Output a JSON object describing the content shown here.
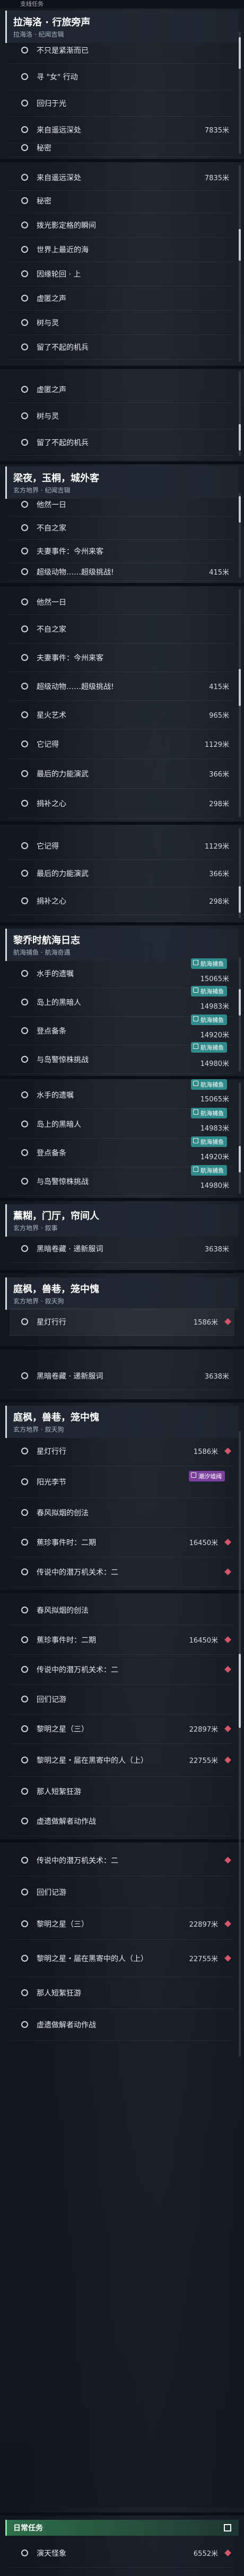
{
  "topbar": {
    "label": "支线任务"
  },
  "block1": {
    "header": {
      "title": "拉海洛 · 行旅旁声",
      "sub": "拉海洛 · 纪闻吉辑"
    },
    "rows": [
      {
        "label": "不只是紧渐而已"
      },
      {
        "label": "寻 \"女\" 行动"
      },
      {
        "label": "回归于光"
      },
      {
        "label": "来自遥远深处",
        "dist": "7835米"
      },
      {
        "label": "秘密"
      },
      {
        "label": "拨光影定格的瞬间"
      }
    ]
  },
  "block2": {
    "rows": [
      {
        "label": "来自遥远深处",
        "dist": "7835米"
      },
      {
        "label": "秘密"
      },
      {
        "label": "拨光影定格的瞬间"
      },
      {
        "label": "世界上最近的海"
      },
      {
        "label": "因缘轮回 · 上"
      },
      {
        "label": "虚匿之声"
      },
      {
        "label": "树与灵"
      },
      {
        "label": "留了不起的机兵"
      }
    ]
  },
  "block3": {
    "rows": [
      {
        "label": "虚匿之声"
      },
      {
        "label": "树与灵"
      },
      {
        "label": "留了不起的机兵"
      }
    ]
  },
  "block4": {
    "header": {
      "title": "梁夜，玉桐，城外客",
      "sub": "玄方地界 · 纪闻吉辑"
    },
    "rows": [
      {
        "label": "他然一日"
      },
      {
        "label": "不自之家"
      },
      {
        "label": "夫妻事件：今州来客"
      },
      {
        "label": "超级动物……超级挑战!",
        "dist": "415米"
      }
    ]
  },
  "block5": {
    "rows": [
      {
        "label": "他然一日"
      },
      {
        "label": "不自之家"
      },
      {
        "label": "夫妻事件：今州来客"
      },
      {
        "label": "超级动物……超级挑战!",
        "dist": "415米"
      },
      {
        "label": "星火艺术",
        "dist": "965米"
      },
      {
        "label": "它记得",
        "dist": "1129米"
      },
      {
        "label": "最后的力能演武",
        "dist": "366米"
      },
      {
        "label": "捐补之心",
        "dist": "298米"
      }
    ]
  },
  "block6": {
    "rows": [
      {
        "label": "它记得",
        "dist": "1129米"
      },
      {
        "label": "最后的力能演武",
        "dist": "366米"
      },
      {
        "label": "捐补之心",
        "dist": "298米"
      }
    ]
  },
  "block7": {
    "header": {
      "title": "黎乔时航海日志",
      "sub": "航海捕鱼 · 航海奇遇"
    },
    "badge": "航海捕鱼",
    "rows": [
      {
        "label": "水手的遗嘱",
        "dist": "15065米"
      },
      {
        "label": "岛上的黑暗人",
        "dist": "14983米"
      },
      {
        "label": "登点备条",
        "dist": "14920米"
      },
      {
        "label": "与岛警惊株挑战",
        "dist": "14980米"
      }
    ]
  },
  "block8": {
    "rows": [
      {
        "label": "水手的遗嘱",
        "dist": "15065米"
      },
      {
        "label": "岛上的黑暗人",
        "dist": "14983米"
      },
      {
        "label": "登点备条",
        "dist": "14920米"
      },
      {
        "label": "与岛警惊株挑战",
        "dist": "14980米"
      }
    ]
  },
  "block9": {
    "header": {
      "title": "薰糊，门厅，帘间人",
      "sub": "玄方地界 · 叙事"
    },
    "rows": [
      {
        "label": "黑暗卷藏 · 递新服词",
        "dist": "3638米"
      }
    ]
  },
  "block10": {
    "header": {
      "title": "庭枫，兽巷，笼中愧",
      "sub": "玄方地界 · 叙天狗"
    },
    "rows": [
      {
        "label": "星灯行行",
        "dist": "1586米"
      }
    ]
  },
  "block11": {
    "rows": [
      {
        "label": "黑暗卷藏 · 递新服词",
        "dist": "3638米"
      }
    ]
  },
  "block12": {
    "header": {
      "title": "庭枫，兽巷，笼中愧",
      "sub": "玄方地界 · 叙天狗"
    },
    "badge": "潮汐墟阈",
    "rows": [
      {
        "label": "星灯行行",
        "dist": "1586米"
      },
      {
        "label": "阳光李节"
      },
      {
        "label": "春风拟烟的创法"
      },
      {
        "label": "蕉珍事件时：二期",
        "dist": "16450米"
      },
      {
        "label": "传说中的潜万机关术：二"
      },
      {
        "label": "春风拟烟的创法"
      },
      {
        "label": "蕉珍事件时：二期",
        "dist": "16450米"
      },
      {
        "label": "传说中的潜万机关术：二"
      },
      {
        "label": "回们记游"
      },
      {
        "label": "黎明之星（三）",
        "dist": "22897米"
      },
      {
        "label": "黎明之星・届在黑寄中的人（上）",
        "dist": "22755米"
      },
      {
        "label": "那人短絮狂游"
      },
      {
        "label": "虚遗做解者动作战"
      },
      {
        "label": "传说中的潜万机关术：二"
      },
      {
        "label": "回们记游"
      },
      {
        "label": "黎明之星（三）",
        "dist": "22897米"
      },
      {
        "label": "黎明之星・届在黑寄中的人（上）",
        "dist": "22755米"
      },
      {
        "label": "那人短絮狂游"
      },
      {
        "label": "虚遗做解者动作战"
      }
    ]
  },
  "daily": {
    "label": "日常任务"
  },
  "last_row": {
    "label": "演天怪象",
    "dist": "6552米"
  }
}
